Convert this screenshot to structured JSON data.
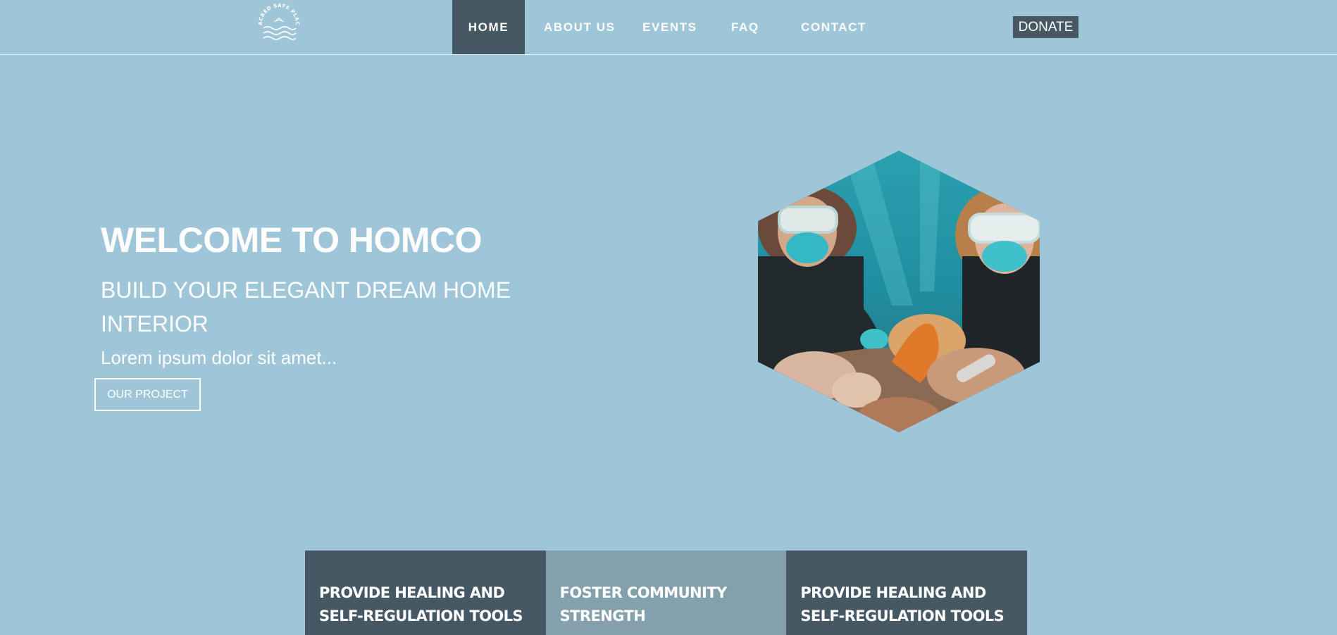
{
  "logo": {
    "text": "SACRED SAFE PLACE"
  },
  "nav": {
    "items": [
      {
        "label": "HOME",
        "active": true
      },
      {
        "label": "ABOUT US"
      },
      {
        "label": "EVENTS"
      },
      {
        "label": "FAQ"
      },
      {
        "label": "CONTACT"
      }
    ],
    "donate_label": "DONATE"
  },
  "hero": {
    "title": "WELCOME TO HOMCO",
    "subtitle": "BUILD YOUR ELEGANT DREAM HOME INTERIOR",
    "text": "Lorem ipsum dolor sit amet...",
    "button_label": "OUR PROJECT"
  },
  "cards": [
    {
      "title": "PROVIDE HEALING AND SELF-REGULATION TOOLS"
    },
    {
      "title": "FOSTER COMMUNITY STRENGTH"
    },
    {
      "title": "PROVIDE HEALING AND SELF-REGULATION TOOLS"
    }
  ],
  "colors": {
    "background": "#9fc5d9",
    "dark": "#455863",
    "mid": "#84a0ad",
    "accent": "#ffffff"
  }
}
